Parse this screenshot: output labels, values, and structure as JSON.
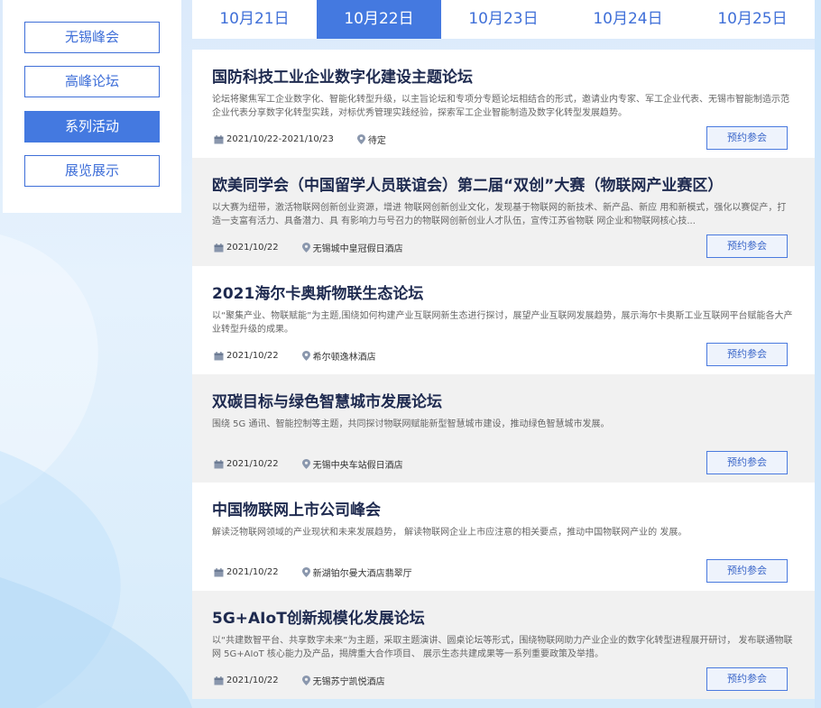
{
  "sidebar": {
    "items": [
      {
        "label": "无锡峰会",
        "active": false
      },
      {
        "label": "高峰论坛",
        "active": false
      },
      {
        "label": "系列活动",
        "active": true
      },
      {
        "label": "展览展示",
        "active": false
      }
    ]
  },
  "dates": {
    "tabs": [
      {
        "label": "10月21日",
        "active": false
      },
      {
        "label": "10月22日",
        "active": true
      },
      {
        "label": "10月23日",
        "active": false
      },
      {
        "label": "10月24日",
        "active": false
      },
      {
        "label": "10月25日",
        "active": false
      }
    ]
  },
  "events": [
    {
      "title": "国防科技工业企业数字化建设主题论坛",
      "description": "论坛将聚焦军工企业数字化、智能化转型升级，以主旨论坛和专项分专题论坛相结合的形式，邀请业内专家、军工企业代表、无锡市智能制造示范企业代表分享数字化转型实践，对标优秀管理实践经验，探索军工企业智能制造及数字化转型发展趋势。",
      "date": "2021/10/22-2021/10/23",
      "location": "待定",
      "button": "预约参会"
    },
    {
      "title": "欧美同学会（中国留学人员联谊会）第二届“双创”大赛（物联网产业赛区）",
      "description": "以大赛为纽带，激活物联网创新创业资源，增进 物联网创新创业文化，发现基于物联网的新技术、新产品、新应 用和新模式，强化以赛促产，打造一支富有活力、具备潜力、具 有影响力与号召力的物联网创新创业人才队伍，宣传江苏省物联 网企业和物联网核心技...",
      "date": "2021/10/22",
      "location": "无锡城中皇冠假日酒店",
      "button": "预约参会"
    },
    {
      "title": "2021海尔卡奥斯物联生态论坛",
      "description": "以“聚集产业、物联赋能”为主题,围绕如何构建产业互联网新生态进行探讨，展望产业互联网发展趋势，展示海尔卡奥斯工业互联网平台赋能各大产业转型升级的成果。",
      "date": "2021/10/22",
      "location": "希尔顿逸林酒店",
      "button": "预约参会"
    },
    {
      "title": "双碳目标与绿色智慧城市发展论坛",
      "description": "围绕 5G 通讯、智能控制等主题，共同探讨物联网赋能新型智慧城市建设，推动绿色智慧城市发展。",
      "date": "2021/10/22",
      "location": "无锡中央车站假日酒店",
      "button": "预约参会"
    },
    {
      "title": "中国物联网上市公司峰会",
      "description": "解读泛物联网领域的产业现状和未来发展趋势， 解读物联网企业上市应注意的相关要点，推动中国物联网产业的 发展。",
      "date": "2021/10/22",
      "location": "新湖铂尔曼大酒店翡翠厅",
      "button": "预约参会"
    },
    {
      "title": "5G+AIoT创新规模化发展论坛",
      "description": "以“共建数智平台、共享数字未来”为主题，采取主题演讲、圆桌论坛等形式，围绕物联网助力产业企业的数字化转型进程展开研讨， 发布联通物联网 5G+AIoT 核心能力及产品，揭牌重大合作项目、 展示生态共建成果等一系列重要政策及举措。",
      "date": "2021/10/22",
      "location": "无锡苏宁凯悦酒店",
      "button": "预约参会"
    }
  ]
}
